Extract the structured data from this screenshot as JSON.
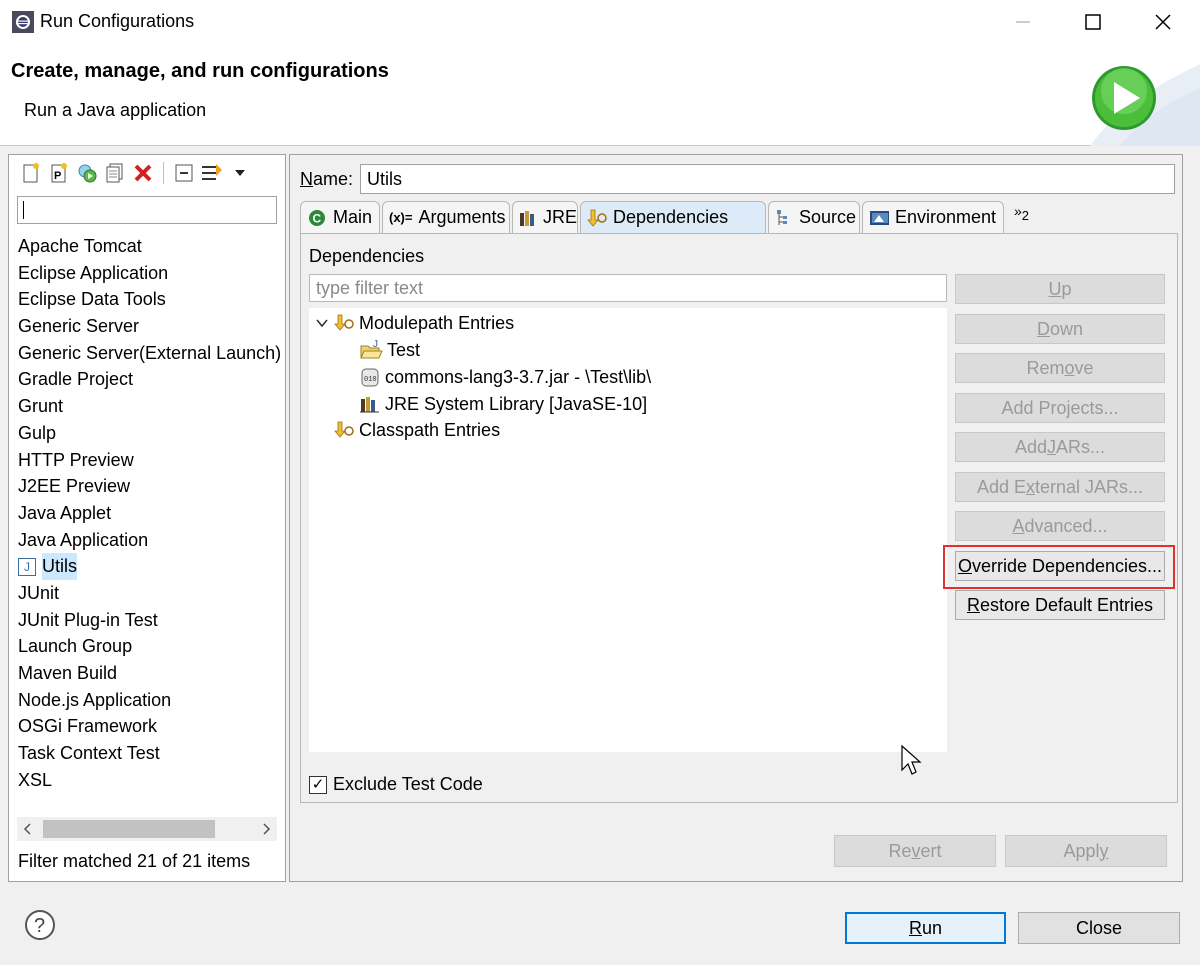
{
  "window": {
    "title": "Run Configurations"
  },
  "header": {
    "title": "Create, manage, and run configurations",
    "subtitle": "Run a Java application"
  },
  "left": {
    "filter_value": "",
    "items": [
      "Apache Tomcat",
      "Eclipse Application",
      "Eclipse Data Tools",
      "Generic Server",
      "Generic Server(External Launch)",
      "Gradle Project",
      "Grunt",
      "Gulp",
      "HTTP Preview",
      "J2EE Preview",
      "Java Applet",
      "Java Application",
      "Utils",
      "JUnit",
      "JUnit Plug-in Test",
      "Launch Group",
      "Maven Build",
      "Node.js Application",
      "OSGi Framework",
      "Task Context Test",
      "XSL"
    ],
    "selected_item": "Utils",
    "status": "Filter matched 21 of 21 items"
  },
  "right": {
    "name_label": "Name:",
    "name_value": "Utils",
    "tabs": [
      "Main",
      "Arguments",
      "JRE",
      "Dependencies",
      "Source",
      "Environment"
    ],
    "tab_overflow": "2",
    "active_tab": "Dependencies",
    "deps_heading": "Dependencies",
    "deps_filter_placeholder": "type filter text",
    "tree": {
      "modulepath": "Modulepath Entries",
      "modulepath_children": [
        "Test",
        "commons-lang3-3.7.jar - \\Test\\lib\\",
        "JRE System Library [JavaSE-10]"
      ],
      "classpath": "Classpath Entries"
    },
    "buttons": {
      "up": "Up",
      "down": "Down",
      "remove": "Remove",
      "add_projects": "Add Projects...",
      "add_jars": "Add JARs...",
      "add_external_jars": "Add External JARs...",
      "advanced": "Advanced...",
      "override": "Override Dependencies...",
      "restore": "Restore Default Entries"
    },
    "exclude_label": "Exclude Test Code",
    "exclude_checked": true,
    "revert": "Revert",
    "apply": "Apply"
  },
  "footer": {
    "run": "Run",
    "close": "Close"
  }
}
